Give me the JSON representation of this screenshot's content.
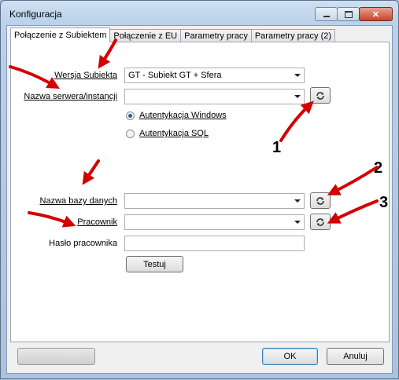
{
  "window": {
    "title": "Konfiguracja"
  },
  "tabs": [
    "Połączenie z Subiektem",
    "Połączenie z EU",
    "Parametry pracy",
    "Parametry pracy (2)"
  ],
  "form": {
    "wersja_label": "Wersja Subiekta",
    "wersja_value": "GT - Subiekt GT + Sfera",
    "serwer_label": "Nazwa serwera/instancji",
    "serwer_value": "",
    "auth_windows": "Autentykacja Windows",
    "auth_sql": "Autentykacja SQL",
    "auth_selected": "Autentykacja Windows",
    "baza_label": "Nazwa bazy danych",
    "baza_value": "",
    "pracownik_label": "Pracownik",
    "pracownik_value": "",
    "haslo_label": "Hasło pracownika",
    "haslo_value": "",
    "test_button": "Testuj"
  },
  "buttons": {
    "ok": "OK",
    "cancel": "Anuluj",
    "blank": ""
  },
  "annotations": [
    "1",
    "2",
    "3"
  ],
  "colors": {
    "arrow": "#d40000"
  }
}
